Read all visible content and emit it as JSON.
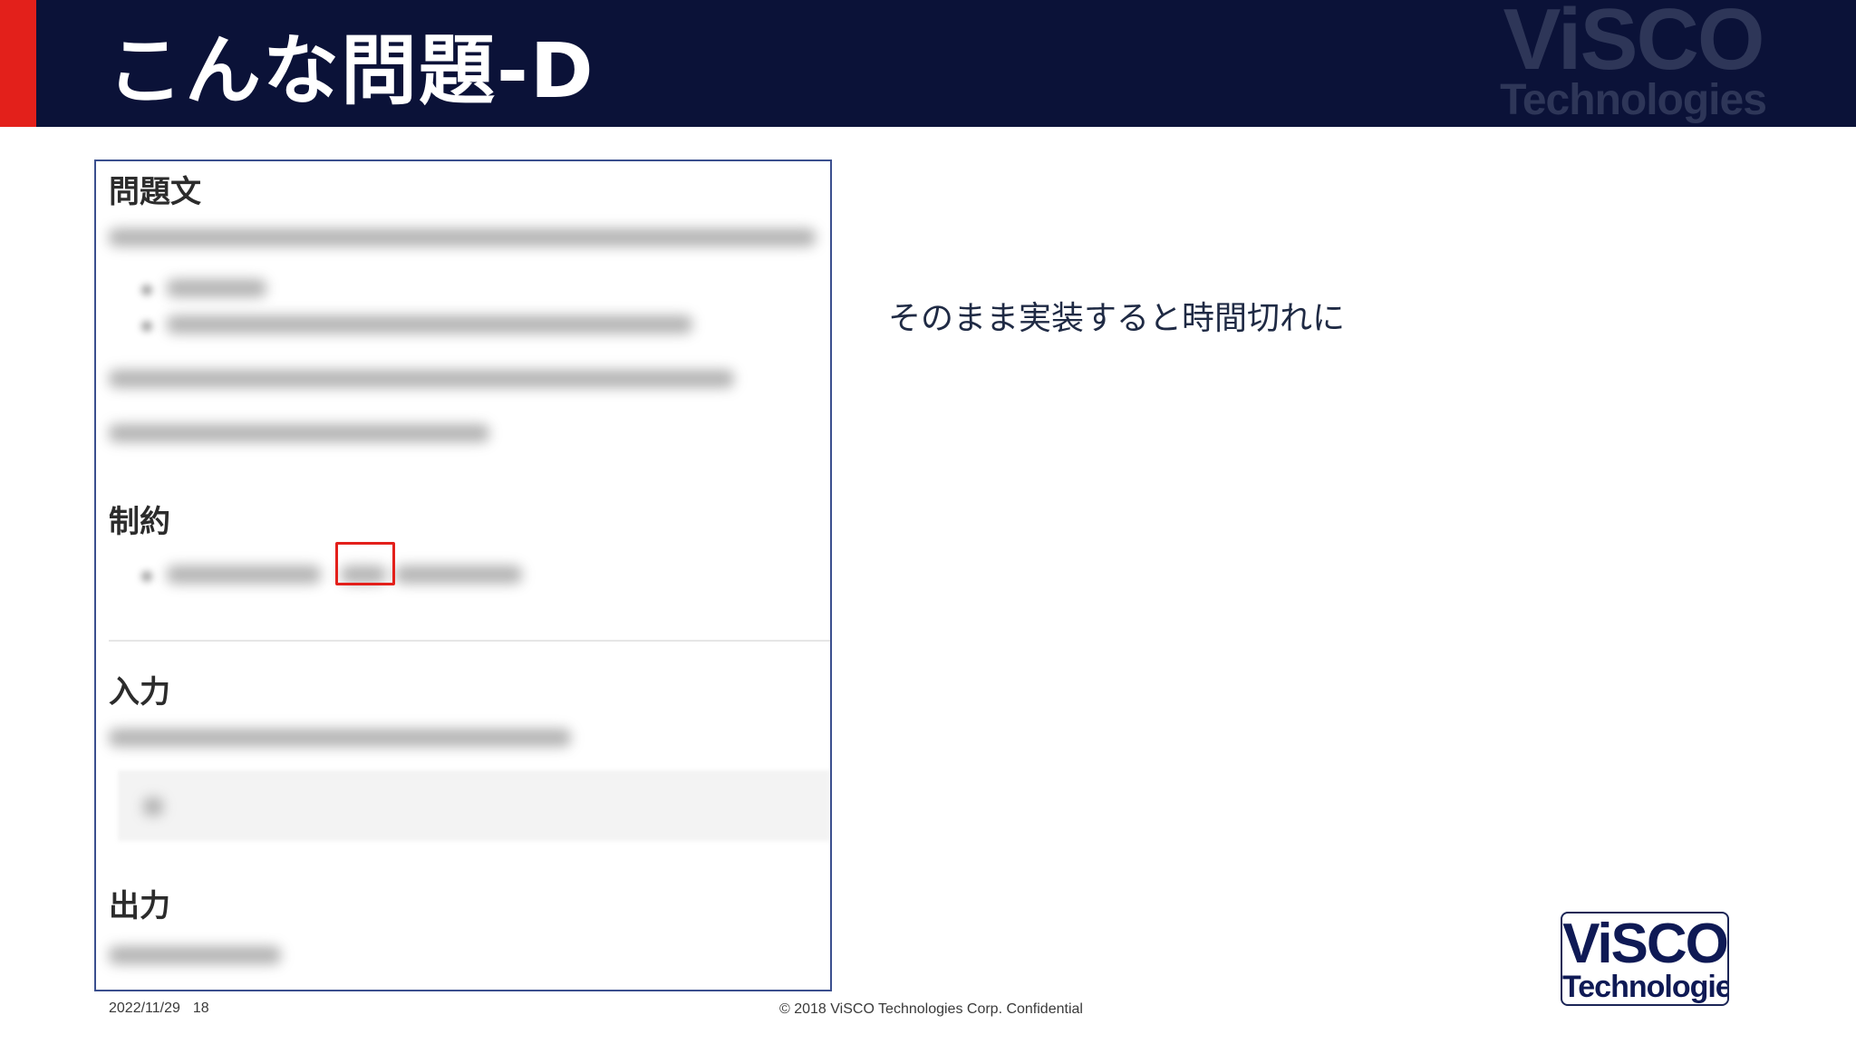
{
  "header": {
    "title": "こんな問題-D",
    "watermark_top": "ViSCO",
    "watermark_bottom": "Technologies"
  },
  "panel": {
    "sections": [
      {
        "heading": "問題文"
      },
      {
        "heading": "制約"
      },
      {
        "heading": "入力"
      },
      {
        "heading": "出力"
      }
    ]
  },
  "note": "そのまま実装すると時間切れに",
  "logo": {
    "top": "ViSCO",
    "bottom": "Technologies"
  },
  "footer": {
    "date": "2022/11/29",
    "page": "18",
    "copyright": "© 2018  ViSCO Technologies Corp.  Confidential"
  },
  "colors": {
    "header_bg": "#0b1238",
    "accent_red": "#e3201b",
    "panel_border": "#3b4f8e",
    "text_dark": "#1f2a44"
  }
}
